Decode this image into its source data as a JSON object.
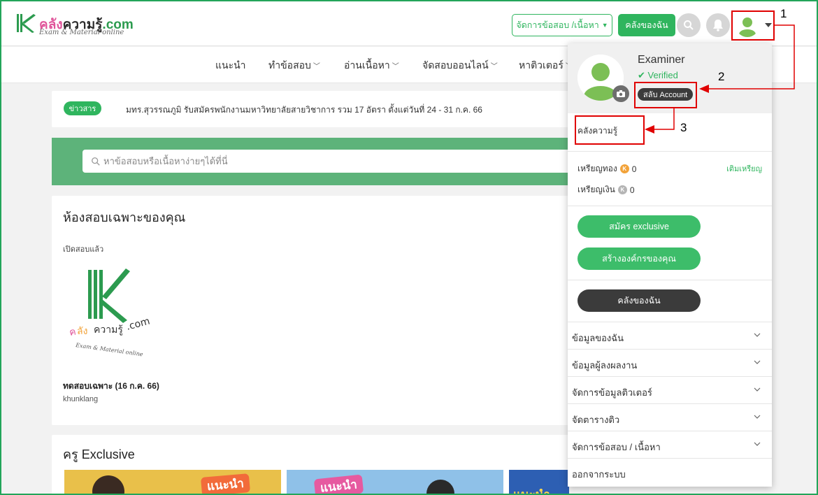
{
  "header": {
    "brand_name": "คลังความรู้.com",
    "brand_part1": "คลัง",
    "brand_part2": "ความรู้",
    "brand_part3": ".com",
    "brand_tagline": "Exam & Material online",
    "manage_button": "จัดการข้อสอบ /เนื้อหา",
    "my_library_button": "คลังของฉัน"
  },
  "nav": {
    "items": [
      {
        "label": "แนะนำ"
      },
      {
        "label": "ทำข้อสอบ"
      },
      {
        "label": "อ่านเนื้อหา"
      },
      {
        "label": "จัดสอบออนไลน์"
      },
      {
        "label": "หาติวเตอร์"
      }
    ]
  },
  "news": {
    "badge": "ข่าวสาร",
    "text": "มทร.สุวรรณภูมิ รับสมัครพนักงานมหาวิทยาลัยสายวิชาการ รวม 17 อัตรา ตั้งแต่วันที่ 24 - 31 ก.ค. 66"
  },
  "search": {
    "placeholder": "หาข้อสอบหรือเนื้อหาง่ายๆได้ที่นี่"
  },
  "exam_room": {
    "title": "ห้องสอบเฉพาะของคุณ",
    "status": "เปิดสอบแล้ว",
    "exam_name": "ทดสอบเฉพาะ (16 ก.ค. 66)",
    "owner": "khunklang"
  },
  "teachers": {
    "title": "ครู Exclusive",
    "badges": [
      "แนะนำ",
      "แนะนำ",
      "แนะนำ"
    ]
  },
  "dropdown": {
    "user_name": "Examiner",
    "verified_label": "Verified",
    "switch_account": "สลับ Account",
    "knowledge_link": "คลังความรู้",
    "gold_coin_label": "เหรียญทอง",
    "gold_coin_value": "0",
    "topup_label": "เติมเหรียญ",
    "silver_coin_label": "เหรียญเงิน",
    "silver_coin_value": "0",
    "exclusive_button": "สมัคร exclusive",
    "create_org_button": "สร้างองค์กรของคุณ",
    "my_library_button": "คลังของฉัน",
    "menu": [
      "ข้อมูลของฉัน",
      "ข้อมูลผู้ลงผลงาน",
      "จัดการข้อมูลติวเตอร์",
      "จัดตารางติว",
      "จัดการข้อสอบ / เนื้อหา"
    ],
    "logout": "ออกจากระบบ"
  },
  "annotations": {
    "labels": [
      "1",
      "2",
      "3"
    ]
  },
  "colors": {
    "brand_green": "#2fb55e",
    "annotation_red": "#e00000",
    "dark_button": "#3b3b3b"
  }
}
